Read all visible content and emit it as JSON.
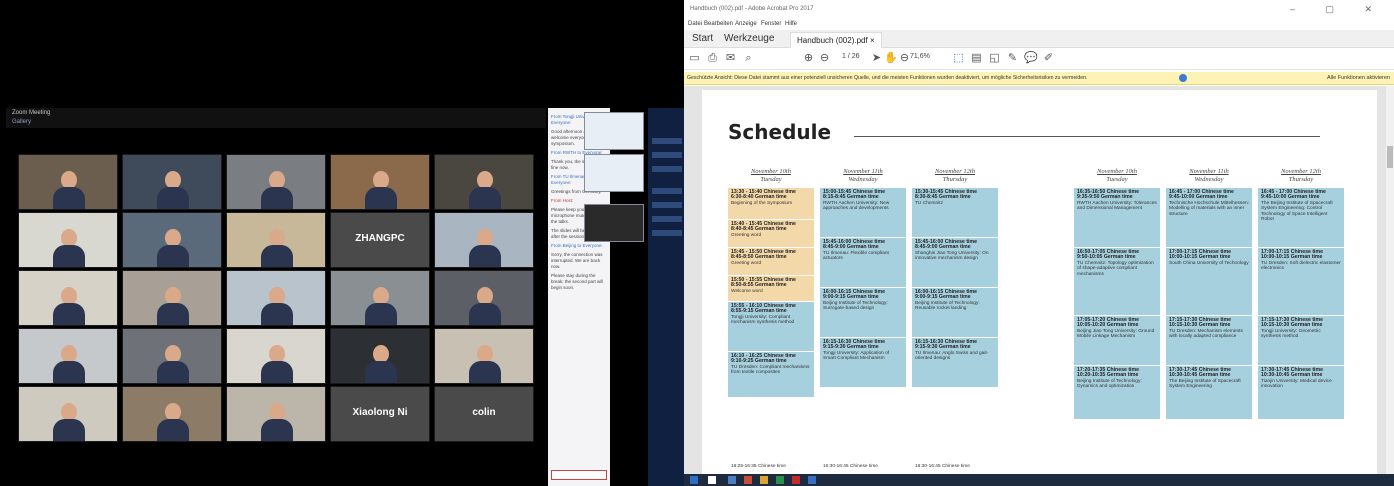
{
  "meeting": {
    "window_title": "Zoom Meeting",
    "subtitle": "Gallery",
    "participants": [
      {
        "name": "",
        "scene": "classroom"
      },
      {
        "name": "",
        "scene": "man-glasses"
      },
      {
        "name": "",
        "scene": "woman"
      },
      {
        "name": "",
        "scene": "man-headset"
      },
      {
        "name": "",
        "scene": "man-dark"
      },
      {
        "name": "",
        "scene": "woman-older"
      },
      {
        "name": "",
        "scene": "man-suit"
      },
      {
        "name": "",
        "scene": "people-room"
      },
      {
        "name": "ZHANGPC",
        "scene": "name-only"
      },
      {
        "name": "",
        "scene": "man-glasses-2"
      },
      {
        "name": "",
        "scene": "man-young"
      },
      {
        "name": "",
        "scene": "woman-2"
      },
      {
        "name": "",
        "scene": "man-3"
      },
      {
        "name": "",
        "scene": "man-4"
      },
      {
        "name": "",
        "scene": "man-5"
      },
      {
        "name": "",
        "scene": "man-6"
      },
      {
        "name": "",
        "scene": "man-7"
      },
      {
        "name": "",
        "scene": "woman-3"
      },
      {
        "name": "",
        "scene": "man-8"
      },
      {
        "name": "",
        "scene": "man-9"
      },
      {
        "name": "",
        "scene": "woman-4"
      },
      {
        "name": "",
        "scene": "man-10"
      },
      {
        "name": "",
        "scene": "woman-5"
      },
      {
        "name": "Xiaolong Ni",
        "scene": "name-only"
      },
      {
        "name": "colin",
        "scene": "name-only"
      }
    ]
  },
  "pdf": {
    "window_title": "Handbuch (002).pdf - Adobe Acrobat Pro 2017",
    "menu": [
      "Datei",
      "Bearbeiten",
      "Anzeige",
      "Fenster",
      "Hilfe"
    ],
    "tabs": {
      "home": "Start",
      "tools": "Werkzeuge",
      "doc": "Handbuch (002).pdf"
    },
    "page_display": "1 / 26",
    "zoom": "71,6%",
    "warning": "Geschützte Ansicht: Diese Datei stammt aus einer potenziell unsicheren Quelle, und die meisten Funktionen wurden deaktiviert, um mögliche Sicherheitsrisiken zu vermeiden.",
    "enable_all": "Alle Funktionen aktivieren",
    "schedule_title": "Schedule",
    "days": [
      {
        "date": "November 10th",
        "dow": "Tuesday",
        "slots": [
          {
            "time": "13:30 - 15:40 Chinese time",
            "sub": "6:30-8:40 German time",
            "text": "Beginning of the Symposium",
            "color": "tan",
            "h": 32
          },
          {
            "time": "15:40 - 15:45 Chinese time",
            "sub": "8:40-8:45 German time",
            "text": "Greeting word",
            "color": "tan",
            "h": 28
          },
          {
            "time": "15:45 - 15:50 Chinese time",
            "sub": "8:45-8:50 German time",
            "text": "Greeting word",
            "color": "tan",
            "h": 28
          },
          {
            "time": "15:50 - 15:55 Chinese time",
            "sub": "8:50-8:55 German time",
            "text": "Welcome word",
            "color": "tan",
            "h": 26
          },
          {
            "time": "15:55 - 16:10 Chinese time",
            "sub": "8:55-9:15 German time",
            "text": "Tongji University: Compliant mechanism synthesis method",
            "color": "blue",
            "h": 50
          },
          {
            "time": "16:10 - 16:25 Chinese time",
            "sub": "9:10-9:25 German time",
            "text": "TU Dresden: Compliant mechanisms from textile composites",
            "color": "blue",
            "h": 46
          }
        ]
      },
      {
        "date": "November 11th",
        "dow": "Wednesday",
        "slots": [
          {
            "time": "15:00-15:45 Chinese time",
            "sub": "8:15-8:45 German time",
            "text": "RWTH Aachen University: New approaches and developments",
            "color": "blue",
            "h": 50
          },
          {
            "time": "15:45-16:00 Chinese time",
            "sub": "8:45-9:00 German time",
            "text": "TU Ilmenau: Flexible compliant actuators",
            "color": "blue",
            "h": 50
          },
          {
            "time": "16:00-16:15 Chinese time",
            "sub": "9:00-9:15 German time",
            "text": "Beijing Institute of Technology: Surrogate-based design",
            "color": "blue",
            "h": 50
          },
          {
            "time": "16:15-16:30 Chinese time",
            "sub": "9:15-9:30 German time",
            "text": "Tongji University: Application of Smart Compliant Mechanism",
            "color": "blue",
            "h": 50
          }
        ]
      },
      {
        "date": "November 12th",
        "dow": "Thursday",
        "slots": [
          {
            "time": "15:30-15:45 Chinese time",
            "sub": "8:30-8:45 German time",
            "text": "TU Chemnitz",
            "color": "blue",
            "h": 50
          },
          {
            "time": "15:45-16:00 Chinese time",
            "sub": "8:45-9:00 German time",
            "text": "Shanghai Jiao Tong University: On innovative mechanism design",
            "color": "blue",
            "h": 50
          },
          {
            "time": "16:00-16:15 Chinese time",
            "sub": "9:00-9:15 German time",
            "text": "Beijing Institute of Technology: Reusable rocket landing",
            "color": "blue",
            "h": 50
          },
          {
            "time": "16:15-16:30 Chinese time",
            "sub": "9:15-9:30 German time",
            "text": "TU Ilmenau: Anglo Swiss and gait-oriented designs",
            "color": "blue",
            "h": 50
          }
        ]
      },
      {
        "date": "November 10th",
        "dow": "Tuesday",
        "slots": [
          {
            "time": "16:35-16:50 Chinese time",
            "sub": "9:35-9:50 German time",
            "text": "RWTH Aachen University: Tolerances and Dimensional Management",
            "color": "blue",
            "h": 60
          },
          {
            "time": "16:50-17:05 Chinese time",
            "sub": "9:50-10:05 German time",
            "text": "TU Chemnitz: Topology optimization of shape-adaptive compliant mechanisms",
            "color": "blue",
            "h": 68
          },
          {
            "time": "17:05-17:20 Chinese time",
            "sub": "10:05-10:20 German time",
            "text": "Beijing Jiao Tong University: Ground Mobile Linkage Mechanism",
            "color": "blue",
            "h": 50
          },
          {
            "time": "17:20-17:35 Chinese time",
            "sub": "10:20-10:35 German time",
            "text": "Beijing Institute of Technology: Dynamics and optimization",
            "color": "blue",
            "h": 54
          }
        ]
      },
      {
        "date": "November 11th",
        "dow": "Wednesday",
        "slots": [
          {
            "time": "16:45 - 17:00 Chinese time",
            "sub": "9:45-10:00 German time",
            "text": "Technische Hochschule Mittelhessen: Modelling of materials with an inner structure",
            "color": "blue",
            "h": 60
          },
          {
            "time": "17:00-17:15 Chinese time",
            "sub": "10:00-10:15 German time",
            "text": "South China University of Technology",
            "color": "blue",
            "h": 68
          },
          {
            "time": "17:15-17:30 Chinese time",
            "sub": "10:15-10:30 German time",
            "text": "TU Dresden: Mechanism elements with locally adapted compliance",
            "color": "blue",
            "h": 50
          },
          {
            "time": "17:30-17:45 Chinese time",
            "sub": "10:30-10:45 German time",
            "text": "The Beijing Institute of Spacecraft System Engineering",
            "color": "blue",
            "h": 54
          }
        ]
      },
      {
        "date": "November 12th",
        "dow": "Thursday",
        "slots": [
          {
            "time": "16:45 - 17:00 Chinese time",
            "sub": "9:45-10:00 German time",
            "text": "The Beijing Institute of Spacecraft System Engineering: Control Technology of Space Intelligent Robot",
            "color": "blue",
            "h": 60
          },
          {
            "time": "17:00-17:15 Chinese time",
            "sub": "10:00-10:15 German time",
            "text": "TU Dresden: Soft dielectric elastomer electronics",
            "color": "blue",
            "h": 68
          },
          {
            "time": "17:15-17:30 Chinese time",
            "sub": "10:15-10:30 German time",
            "text": "Tongji University: Geometric synthesis method",
            "color": "blue",
            "h": 50
          },
          {
            "time": "17:30-17:45 Chinese time",
            "sub": "10:30-10:45 German time",
            "text": "Tianjin University: Medical device innovation",
            "color": "blue",
            "h": 54
          }
        ]
      }
    ],
    "bottom_row": [
      "16:25-16:35 Chinese time",
      "16:30-16:45 Chinese time",
      "16:30-16:45 Chinese time"
    ]
  },
  "colors": {
    "accent": "#2d6fc4",
    "cell_blue": "#a6d0de",
    "cell_tan": "#f3d9a9",
    "warn": "#fdf3b4"
  }
}
